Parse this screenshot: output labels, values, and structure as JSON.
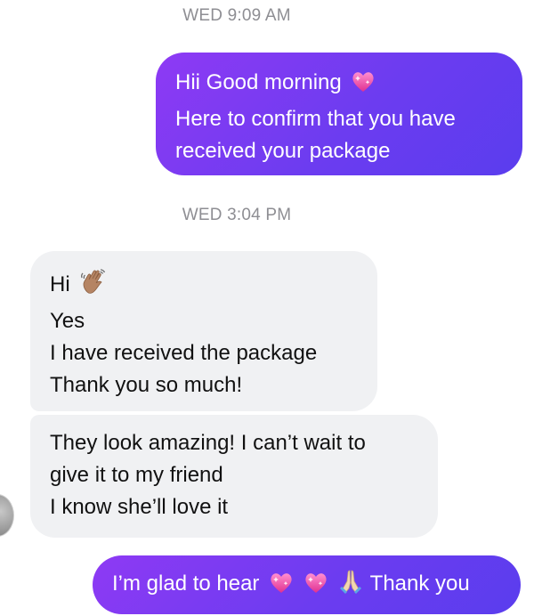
{
  "timestamps": [
    "WED 9:09 AM",
    "WED 3:04 PM"
  ],
  "messages": {
    "out1": {
      "sender": "me",
      "lines": [
        "Hii Good morning",
        "Here to confirm that you have",
        "received your package"
      ],
      "emoji": "sparkling-heart"
    },
    "in1": {
      "sender": "them",
      "lines": [
        "Hi",
        "Yes",
        "I have received the package",
        "Thank you so much!"
      ],
      "emoji": "waving-hand"
    },
    "in2": {
      "sender": "them",
      "lines": [
        "They look amazing! I can’t wait to",
        "give it to my friend",
        "I know she’ll love it"
      ]
    },
    "out2": {
      "sender": "me",
      "text_before": "I’m glad to hear",
      "text_after": "Thank you",
      "emojis": [
        "sparkling-heart",
        "sparkling-heart",
        "folded-hands"
      ]
    }
  },
  "colors": {
    "outgoing_bubble": "#7a3bf2",
    "incoming_bubble": "#f0f1f3",
    "timestamp_text": "#8e8e93"
  }
}
